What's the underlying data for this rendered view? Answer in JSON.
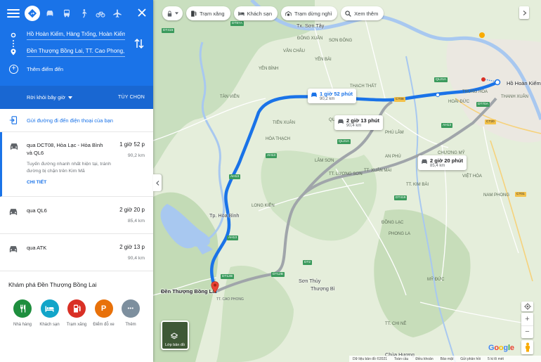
{
  "panel": {
    "modes": [
      "best-route",
      "driving",
      "transit",
      "walking",
      "cycling",
      "flight"
    ],
    "from": "Hồ Hoàn Kiếm, Hàng Trống, Hoàn Kiếm",
    "to": "Đền Thượng Bồng Lai, TT. Cao Phong, C",
    "add_destination": "Thêm điểm đến",
    "depart": "Rời khỏi bây giờ",
    "options": "TÙY CHỌN",
    "send_to_phone": "Gửi đường đi đến điện thoại của bạn",
    "routes": [
      {
        "name": "qua DCT08, Hòa Lạc - Hòa Bình và QL6",
        "time": "1 giờ 52 p",
        "distance": "90,2 km",
        "note": "Tuyến đường nhanh nhất hiện tại, tránh đường bị chặn trên Kim Mã",
        "details": "CHI TIẾT"
      },
      {
        "name": "qua QL6",
        "time": "2 giờ 20 p",
        "distance": "85,4 km"
      },
      {
        "name": "qua ATK",
        "time": "2 giờ 13 p",
        "distance": "90,4 km"
      }
    ],
    "explore_title": "Khám phá Đền Thượng Bồng Lai",
    "explore": [
      {
        "label": "Nhà hàng",
        "color": "#1e8e3e",
        "icon": "restaurant-icon"
      },
      {
        "label": "Khách sạn",
        "color": "#12a5c9",
        "icon": "hotel-icon"
      },
      {
        "label": "Trạm xăng",
        "color": "#d93025",
        "icon": "gas-icon"
      },
      {
        "label": "Điểm đỗ xe",
        "color": "#e8710a",
        "icon": "parking-icon",
        "glyph": "P"
      },
      {
        "label": "Thêm",
        "color": "#5f7d95",
        "icon": "more-icon",
        "glyph": "•••"
      }
    ]
  },
  "chips": {
    "gas": "Trạm xăng",
    "hotel": "Khách sạn",
    "rest": "Trạm dừng nghỉ",
    "more": "Xem thêm"
  },
  "map": {
    "labels": [
      {
        "time": "1 giờ 52 phút",
        "dist": "90,2 km",
        "selected": true
      },
      {
        "time": "2 giờ 13 phút",
        "dist": "90,4 km",
        "selected": false
      },
      {
        "time": "2 giờ 20 phút",
        "dist": "85,4 km",
        "selected": false
      }
    ],
    "origin": "Hồ Hoàn Kiếm",
    "destination": "Đền Thượng Bồng Lai",
    "destination_sub": "TT. CAO PHONG",
    "cities": {
      "son_tay": "Tx. Sơn Tây",
      "hoa_binh": "Tp. Hòa Bình",
      "son_thuy": "Sơn Thủy",
      "thuong_bi": "Thượng Bì",
      "chua_huong": "Chùa Hương"
    },
    "places": [
      "THẠCH THẤT",
      "HOÀI ĐỨC",
      "QUỐC OAI",
      "TIẾN XUÂN",
      "YÊN BÌNH",
      "LÂM SƠN",
      "TT. LƯƠNG SƠN",
      "ĐỒNG LẠC",
      "PHONG LA",
      "MỸ ĐỨC",
      "TT. CHI NÊ",
      "AN PHÚ",
      "HÒA THẠCH",
      "PHÚ LÂM",
      "LONG KIÊN",
      "TT. XUÂN MAI",
      "TT. KIM BÀI",
      "VIỆT HÓA",
      "CHƯƠNG MỸ",
      "YÊN BÀI",
      "VÂN CHÂU",
      "SƠN ĐÔNG",
      "ĐÔNG XUÂN",
      "THANH XUÂN",
      "TRUNG HÒA",
      "NAM PHONG",
      "TÀN VIÊN"
    ],
    "layers_label": "Lớp bản đồ",
    "google": [
      "G",
      "o",
      "o",
      "g",
      "l",
      "e"
    ]
  },
  "footer": {
    "copyright": "Dữ liệu bản đồ ©2021",
    "items": [
      "Toàn cầu",
      "Điều khoản",
      "Bảo mật",
      "Gửi phản hồi",
      "5 ki lô mét"
    ]
  },
  "colors": {
    "accent": "#1a73e8",
    "route_main": "#1a73e8",
    "route_alt": "#a0a5aa"
  }
}
